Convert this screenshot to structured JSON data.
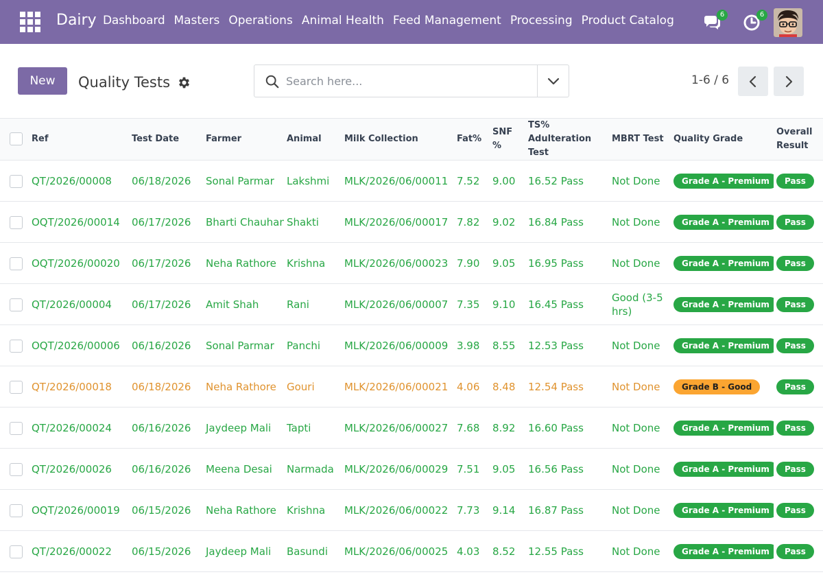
{
  "navbar": {
    "brand": "Dairy",
    "menu": [
      "Dashboard",
      "Masters",
      "Operations",
      "Animal Health",
      "Feed Management",
      "Processing",
      "Product Catalog"
    ],
    "chat_count": "6",
    "activity_count": "6",
    "bg_color": "#7c6aa6"
  },
  "control": {
    "new_label": "New",
    "title": "Quality Tests",
    "search_placeholder": "Search here...",
    "pager": "1-6 / 6"
  },
  "table": {
    "headers": {
      "ref": "Ref",
      "test_date": "Test Date",
      "farmer": "Farmer",
      "animal": "Animal",
      "milk_collection": "Milk Collection",
      "fat": "Fat%",
      "snf": "SNF %",
      "ts_adulteration": "TS% Adulteration Test",
      "mbrt": "MBRT Test",
      "quality_grade": "Quality Grade",
      "overall_result": "Overall Result"
    },
    "rows": [
      {
        "ref": "QT/2026/00008",
        "date": "06/18/2026",
        "farmer": "Sonal Parmar",
        "animal": "Lakshmi",
        "milk": "MLK/2026/06/00011",
        "fat": "7.52",
        "snf": "9.00",
        "ts": "16.52 Pass",
        "mbrt": "Not Done",
        "grade": "Grade A - Premium",
        "result": "Pass",
        "color": "green"
      },
      {
        "ref": "OQT/2026/00014",
        "date": "06/17/2026",
        "farmer": "Bharti Chauhan",
        "animal": "Shakti",
        "milk": "MLK/2026/06/00017",
        "fat": "7.82",
        "snf": "9.02",
        "ts": "16.84 Pass",
        "mbrt": "Not Done",
        "grade": "Grade A - Premium",
        "result": "Pass",
        "color": "green"
      },
      {
        "ref": "OQT/2026/00020",
        "date": "06/17/2026",
        "farmer": "Neha Rathore",
        "animal": "Krishna",
        "milk": "MLK/2026/06/00023",
        "fat": "7.90",
        "snf": "9.05",
        "ts": "16.95 Pass",
        "mbrt": "Not Done",
        "grade": "Grade A - Premium",
        "result": "Pass",
        "color": "green"
      },
      {
        "ref": "QT/2026/00004",
        "date": "06/17/2026",
        "farmer": "Amit Shah",
        "animal": "Rani",
        "milk": "MLK/2026/06/00007",
        "fat": "7.35",
        "snf": "9.10",
        "ts": "16.45 Pass",
        "mbrt": "Good (3-5 hrs)",
        "grade": "Grade A - Premium",
        "result": "Pass",
        "color": "green"
      },
      {
        "ref": "OQT/2026/00006",
        "date": "06/16/2026",
        "farmer": "Sonal Parmar",
        "animal": "Panchi",
        "milk": "MLK/2026/06/00009",
        "fat": "3.98",
        "snf": "8.55",
        "ts": "12.53 Pass",
        "mbrt": "Not Done",
        "grade": "Grade A - Premium",
        "result": "Pass",
        "color": "green"
      },
      {
        "ref": "QT/2026/00018",
        "date": "06/18/2026",
        "farmer": "Neha Rathore",
        "animal": "Gouri",
        "milk": "MLK/2026/06/00021",
        "fat": "4.06",
        "snf": "8.48",
        "ts": "12.54 Pass",
        "mbrt": "Not Done",
        "grade": "Grade B - Good",
        "result": "Pass",
        "color": "orange"
      },
      {
        "ref": "QT/2026/00024",
        "date": "06/16/2026",
        "farmer": "Jaydeep Mali",
        "animal": "Tapti",
        "milk": "MLK/2026/06/00027",
        "fat": "7.68",
        "snf": "8.92",
        "ts": "16.60 Pass",
        "mbrt": "Not Done",
        "grade": "Grade A - Premium",
        "result": "Pass",
        "color": "green"
      },
      {
        "ref": "QT/2026/00026",
        "date": "06/16/2026",
        "farmer": "Meena Desai",
        "animal": "Narmada",
        "milk": "MLK/2026/06/00029",
        "fat": "7.51",
        "snf": "9.05",
        "ts": "16.56 Pass",
        "mbrt": "Not Done",
        "grade": "Grade A - Premium",
        "result": "Pass",
        "color": "green"
      },
      {
        "ref": "OQT/2026/00019",
        "date": "06/15/2026",
        "farmer": "Neha Rathore",
        "animal": "Krishna",
        "milk": "MLK/2026/06/00022",
        "fat": "7.73",
        "snf": "9.14",
        "ts": "16.87 Pass",
        "mbrt": "Not Done",
        "grade": "Grade A - Premium",
        "result": "Pass",
        "color": "green"
      },
      {
        "ref": "QT/2026/00022",
        "date": "06/15/2026",
        "farmer": "Jaydeep Mali",
        "animal": "Basundi",
        "milk": "MLK/2026/06/00025",
        "fat": "4.03",
        "snf": "8.52",
        "ts": "12.55 Pass",
        "mbrt": "Not Done",
        "grade": "Grade A - Premium",
        "result": "Pass",
        "color": "green"
      }
    ]
  }
}
